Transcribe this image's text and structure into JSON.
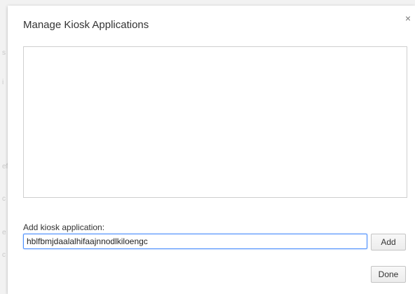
{
  "dialog": {
    "title": "Manage Kiosk Applications",
    "close_glyph": "×",
    "close_icon": "close-icon"
  },
  "app_list": {
    "items": []
  },
  "add_section": {
    "label": "Add kiosk application:",
    "input_value": "hblfbmjdaalalhifaajnnodlkiloengc",
    "add_button_label": "Add"
  },
  "footer": {
    "done_button_label": "Done"
  }
}
